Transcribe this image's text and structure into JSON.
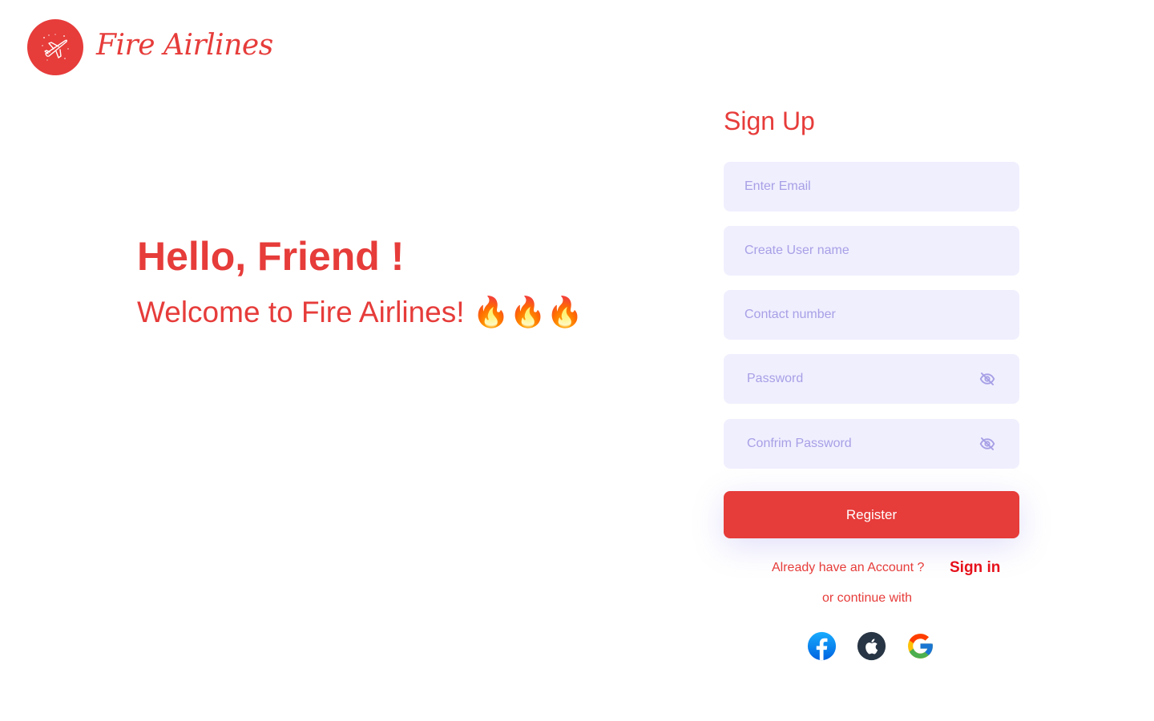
{
  "brand": {
    "name": "Fire Airlines",
    "logo_icon": "airplane-icon",
    "color": "#e63c3a"
  },
  "hero": {
    "title": "Hello, Friend !",
    "subtitle": "Welcome to Fire Airlines! 🔥🔥🔥"
  },
  "form": {
    "title": "Sign Up",
    "email_placeholder": "Enter Email",
    "username_placeholder": "Create User name",
    "contact_placeholder": "Contact number",
    "password_placeholder": "Password",
    "confirm_password_placeholder": "Confrim Password",
    "register_label": "Register",
    "account_text": "Already have an Account ?",
    "signin_label": "Sign in",
    "continue_text": "or continue with",
    "field_bg": "#f0effe",
    "placeholder_color": "#a7a0e6"
  },
  "social": [
    {
      "icon": "facebook-icon",
      "color": "#1877f2"
    },
    {
      "icon": "apple-icon",
      "color": "#283544"
    },
    {
      "icon": "google-icon",
      "color": "#4285f4"
    }
  ]
}
